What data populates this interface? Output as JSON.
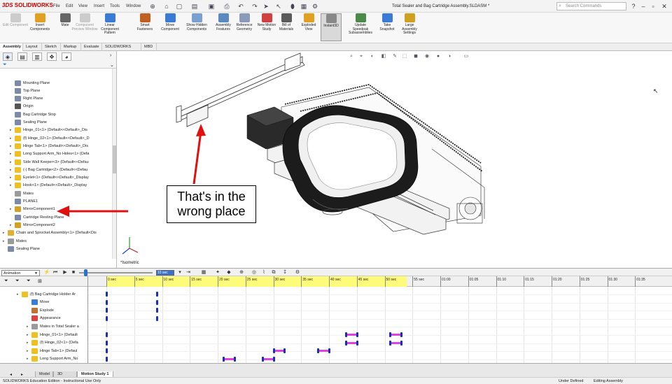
{
  "app": {
    "brand": "SOLIDWORKS",
    "window_title": "Total Sealer and Bag Cartridge Assembly.SLDASM *",
    "menu": [
      "File",
      "Edit",
      "View",
      "Insert",
      "Tools",
      "Window"
    ],
    "search_placeholder": "Search Commands"
  },
  "ribbon": [
    {
      "label": "Edit Component",
      "disabled": true
    },
    {
      "label": "Insert Components",
      "disabled": false
    },
    {
      "label": "Mate",
      "disabled": false
    },
    {
      "label": "Component Preview Window",
      "disabled": true
    },
    {
      "label": "Linear Component Pattern",
      "disabled": false
    },
    {
      "label": "Smart Fasteners",
      "disabled": false
    },
    {
      "label": "Move Component",
      "disabled": false
    },
    {
      "label": "Show Hidden Components",
      "disabled": false
    },
    {
      "label": "Assembly Features",
      "disabled": false
    },
    {
      "label": "Reference Geometry",
      "disabled": false
    },
    {
      "label": "New Motion Study",
      "disabled": false
    },
    {
      "label": "Bill of Materials",
      "disabled": false
    },
    {
      "label": "Exploded View",
      "disabled": false
    },
    {
      "label": "Instant3D",
      "disabled": false,
      "active": true
    },
    {
      "label": "Update Speedpak Subassemblies",
      "disabled": false
    },
    {
      "label": "Take Snapshot",
      "disabled": false
    },
    {
      "label": "Large Assembly Settings",
      "disabled": false
    }
  ],
  "command_tabs": [
    {
      "label": "Assembly",
      "active": true
    },
    {
      "label": "Layout"
    },
    {
      "label": "Sketch"
    },
    {
      "label": "Markup"
    },
    {
      "label": "Evaluate"
    },
    {
      "label": "SOLIDWORKS Add-Ins"
    },
    {
      "label": "MBD"
    }
  ],
  "tree": [
    {
      "label": "Mounting Plane",
      "indent": 1,
      "expander": false,
      "icon": "plane"
    },
    {
      "label": "Top Plane",
      "indent": 1,
      "expander": false,
      "icon": "plane"
    },
    {
      "label": "Right Plane",
      "indent": 1,
      "expander": false,
      "icon": "plane"
    },
    {
      "label": "Origin",
      "indent": 1,
      "expander": false,
      "icon": "origin"
    },
    {
      "label": "Bag Cartridge Stop",
      "indent": 1,
      "expander": false,
      "icon": "plane"
    },
    {
      "label": "Sealing Plane",
      "indent": 1,
      "expander": false,
      "icon": "plane"
    },
    {
      "label": "Hinge_01<1> (Default<<Default>_Dis",
      "indent": 1,
      "expander": true,
      "icon": "part"
    },
    {
      "label": "(f) Hinge_02<1> (Default<<Default>_D",
      "indent": 1,
      "expander": true,
      "icon": "part"
    },
    {
      "label": "Hinge Tab<1> (Default<<Default>_Dis",
      "indent": 1,
      "expander": true,
      "icon": "part"
    },
    {
      "label": "Long Support Arm_No Holes<1> (Defa",
      "indent": 1,
      "expander": true,
      "icon": "part"
    },
    {
      "label": "Side Wall Keeper<3> (Default<<Defau",
      "indent": 1,
      "expander": true,
      "icon": "part"
    },
    {
      "label": "(-) Bag Cartridge<2> (Default<<Defau",
      "indent": 1,
      "expander": true,
      "icon": "part"
    },
    {
      "label": "Eyelet<1> (Default<<Default>_Display",
      "indent": 1,
      "expander": true,
      "icon": "part"
    },
    {
      "label": "Hook<1> (Default<<Default>_Display",
      "indent": 1,
      "expander": true,
      "icon": "part"
    },
    {
      "label": "Mates",
      "indent": 1,
      "expander": false,
      "icon": "mates"
    },
    {
      "label": "PLANE1",
      "indent": 1,
      "expander": false,
      "icon": "plane"
    },
    {
      "label": "MirrorComponent1",
      "indent": 1,
      "expander": true,
      "icon": "mirror"
    },
    {
      "label": "Cartridge Resting Plane",
      "indent": 1,
      "expander": false,
      "icon": "plane"
    },
    {
      "label": "MirrorComponent2",
      "indent": 1,
      "expander": true,
      "icon": "mirror"
    },
    {
      "label": "Chain and Sprocket Assembly<1> (Default<Dis",
      "indent": 0,
      "expander": true,
      "icon": "assy"
    },
    {
      "label": "Mates",
      "indent": 0,
      "expander": true,
      "icon": "mates"
    },
    {
      "label": "Sealing Plane",
      "indent": 0,
      "expander": false,
      "icon": "plane"
    }
  ],
  "annotation": {
    "line1": "That's in the",
    "line2": "wrong place"
  },
  "view_label": "*Isometric",
  "motion": {
    "study_type": "Animation",
    "time_field": "10 sec",
    "rows": [
      {
        "label": "(f) Bag Cartridge Holder Ar",
        "indent": 1,
        "expander": true,
        "icon": "part"
      },
      {
        "label": "Move",
        "indent": 2,
        "expander": false,
        "icon": "move"
      },
      {
        "label": "Explode",
        "indent": 2,
        "expander": false,
        "icon": "explode"
      },
      {
        "label": "Appearance",
        "indent": 2,
        "expander": false,
        "icon": "appearance"
      },
      {
        "label": "Mates in Total Sealer a",
        "indent": 2,
        "expander": true,
        "icon": "mates"
      },
      {
        "label": "Hinge_01<1> (Default",
        "indent": 2,
        "expander": true,
        "icon": "part"
      },
      {
        "label": "(f) Hinge_02<1> (Defa",
        "indent": 2,
        "expander": true,
        "icon": "part"
      },
      {
        "label": "Hinge Tab<1> (Defaul",
        "indent": 2,
        "expander": true,
        "icon": "part"
      },
      {
        "label": "Long Support Arm_No",
        "indent": 2,
        "expander": true,
        "icon": "part"
      }
    ],
    "timeline_labels": [
      "0 sec",
      "5 sec",
      "10 sec",
      "15 sec",
      "20 sec",
      "25 sec",
      "30 sec",
      "35 sec",
      "40 sec",
      "45 sec",
      "50 sec",
      "55 sec",
      "01:00",
      "01:05",
      "01:10",
      "01:15",
      "01:20",
      "01:25",
      "01:30",
      "01:35"
    ],
    "highlight_end_sec": 54,
    "keyframes": [
      {
        "row": 0,
        "t": 0
      },
      {
        "row": 0,
        "t": 9
      },
      {
        "row": 1,
        "t": 0
      },
      {
        "row": 1,
        "t": 9
      },
      {
        "row": 2,
        "t": 0
      },
      {
        "row": 2,
        "t": 9
      },
      {
        "row": 3,
        "t": 0
      },
      {
        "row": 3,
        "t": 9
      },
      {
        "row": 5,
        "t": 0
      },
      {
        "row": 6,
        "t": 0
      },
      {
        "row": 7,
        "t": 0
      },
      {
        "row": 8,
        "t": 0
      }
    ],
    "spans": [
      {
        "row": 5,
        "t0": 43,
        "t1": 45
      },
      {
        "row": 5,
        "t0": 51,
        "t1": 53
      },
      {
        "row": 6,
        "t0": 43,
        "t1": 45
      },
      {
        "row": 6,
        "t0": 51,
        "t1": 53
      },
      {
        "row": 7,
        "t0": 30,
        "t1": 32
      },
      {
        "row": 7,
        "t0": 38,
        "t1": 40
      },
      {
        "row": 8,
        "t0": 21,
        "t1": 23
      },
      {
        "row": 8,
        "t0": 28,
        "t1": 30
      }
    ]
  },
  "bottom_tabs": [
    {
      "label": "Model"
    },
    {
      "label": "3D Views"
    },
    {
      "label": "Motion Study 1",
      "active": true
    }
  ],
  "status": {
    "left": "SOLIDWORKS Education Edition - Instructional Use Only",
    "state": "Under Defined",
    "mode": "Editing Assembly"
  },
  "icon_colors": {
    "part": "#f0c020",
    "plane": "#7a8aa8",
    "mates": "#9a9a9a",
    "mirror": "#d4a020",
    "assy": "#e0b030",
    "origin": "#555555",
    "move": "#3a7bd5",
    "explode": "#c07030",
    "appearance": "#e04040"
  }
}
